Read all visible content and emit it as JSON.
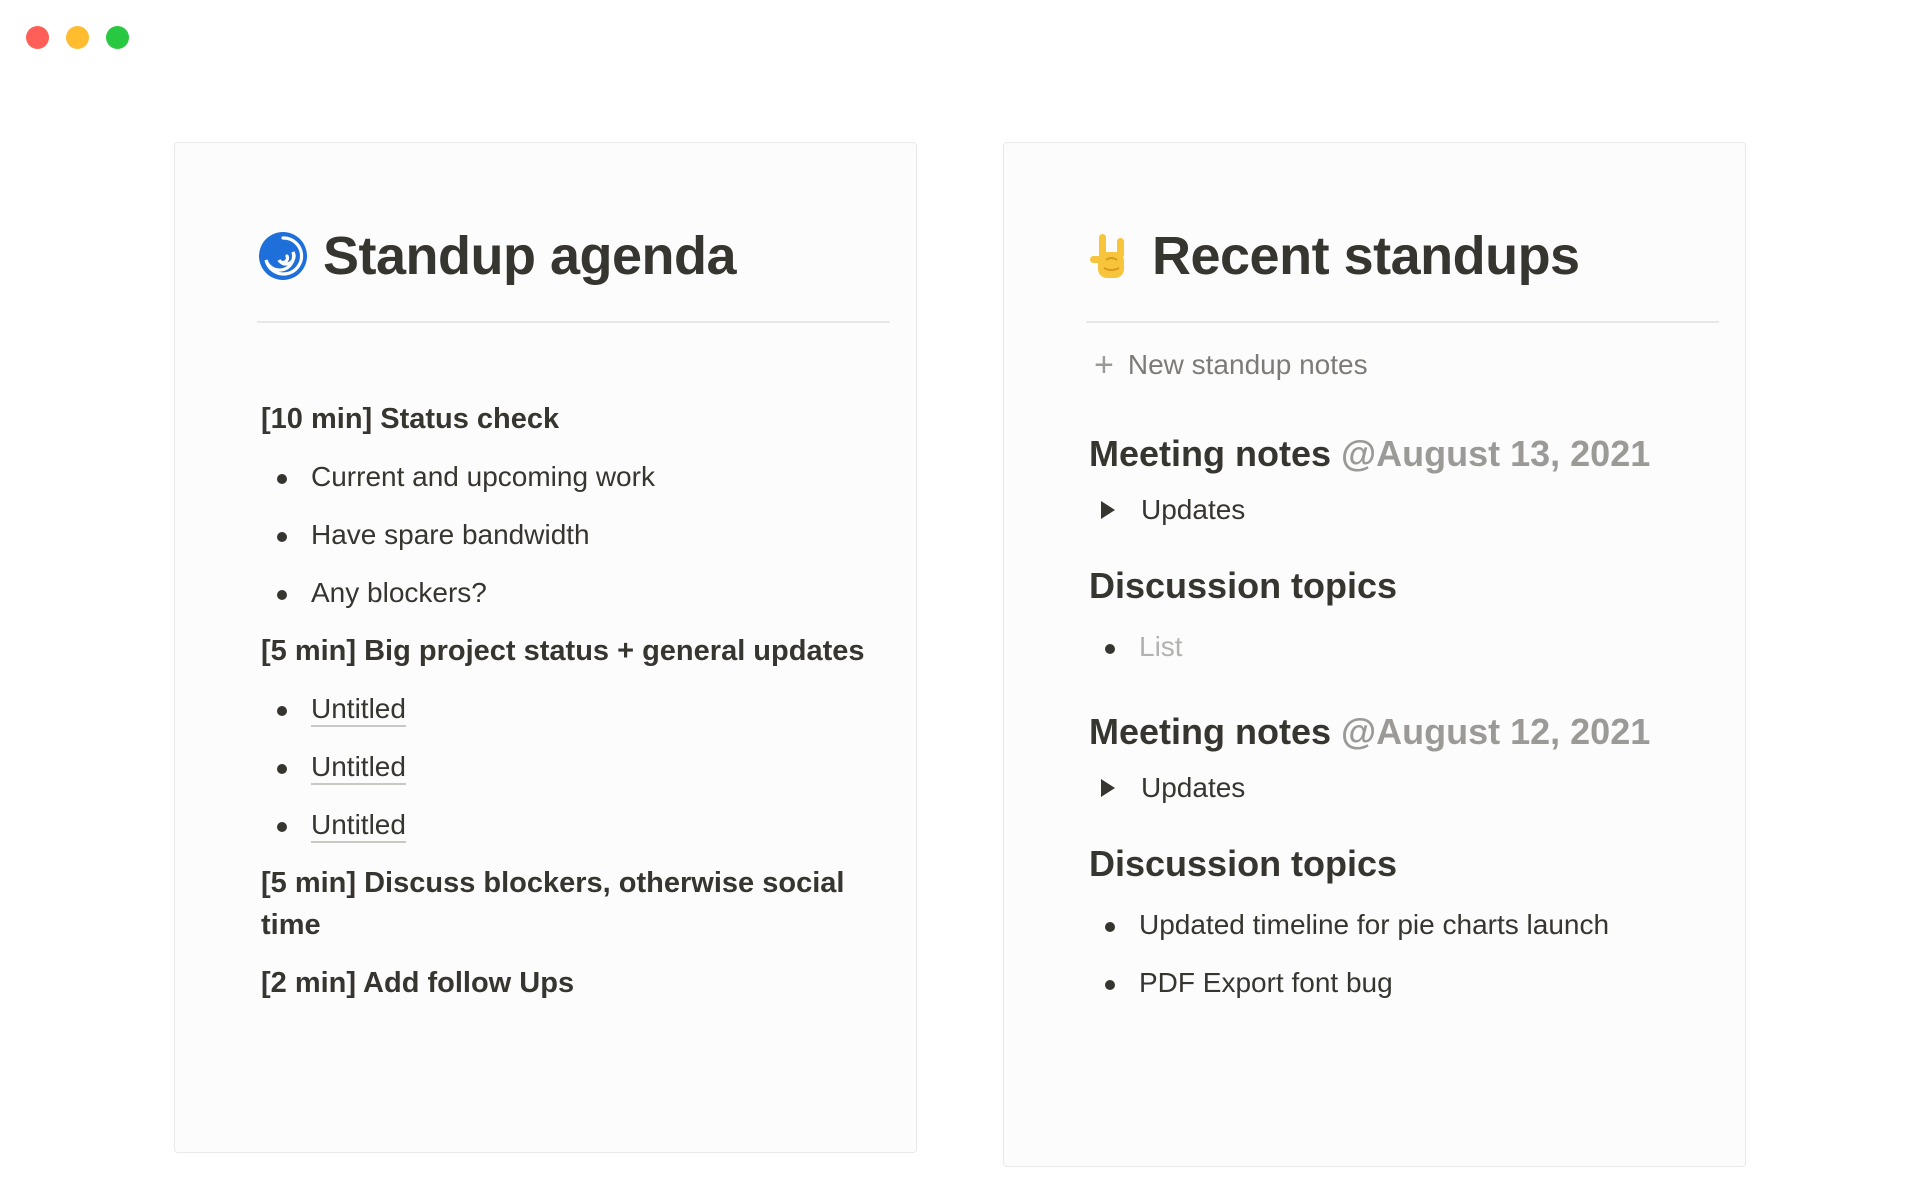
{
  "window": {
    "controls": [
      "close",
      "minimize",
      "zoom"
    ]
  },
  "agenda_card": {
    "icon": "cyclone-emoji-icon",
    "title": "Standup agenda",
    "sections": [
      {
        "heading": "[10 min] Status check",
        "items": [
          "Current and upcoming work",
          "Have spare bandwidth",
          "Any blockers?"
        ]
      },
      {
        "heading": "[5 min] Big project status + general updates",
        "items": [
          "Untitled",
          "Untitled",
          "Untitled"
        ]
      },
      {
        "heading": "[5 min] Discuss blockers, otherwise social time",
        "items": []
      },
      {
        "heading": "[2 min] Add follow Ups",
        "items": []
      }
    ]
  },
  "recent_card": {
    "icon": "sign-of-horns-emoji-icon",
    "title": "Recent standups",
    "new_button": "New standup notes",
    "meetings": [
      {
        "label": "Meeting notes",
        "date": "@August 13, 2021",
        "toggle": "Updates",
        "topics_heading": "Discussion topics",
        "topics": [
          "List"
        ],
        "topics_placeholder": true
      },
      {
        "label": "Meeting notes",
        "date": "@August 12, 2021",
        "toggle": "Updates",
        "topics_heading": "Discussion topics",
        "topics": [
          "Updated timeline for pie charts launch",
          "PDF Export font bug"
        ],
        "topics_placeholder": false
      }
    ]
  },
  "colors": {
    "text": "#37352f",
    "muted": "#9b9a97",
    "placeholder": "#b3b2af",
    "card_border": "#e9e8ea"
  }
}
